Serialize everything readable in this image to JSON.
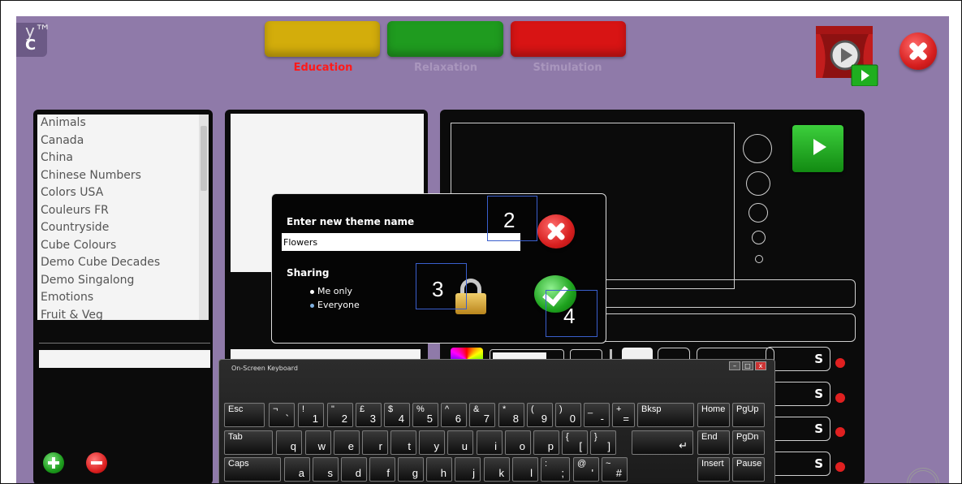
{
  "header": {
    "logo": {
      "top": "y™",
      "bottom": "C"
    },
    "categories": [
      {
        "label": "Education",
        "color": "#d3ad0b",
        "label_color": "#ff1a1a"
      },
      {
        "label": "Relaxation",
        "color": "#1f9b1f",
        "label_color": "#a996bd"
      },
      {
        "label": "Stimulation",
        "color": "#d81414",
        "label_color": "#a996bd"
      }
    ]
  },
  "theme_list": {
    "items": [
      "Animals",
      "Canada",
      "China",
      "Chinese Numbers",
      "Colors USA",
      "Couleurs FR",
      "Countryside",
      "Cube Colours",
      "Demo Cube Decades",
      "Demo Singalong",
      "Emotions",
      "Fruit & Veg"
    ]
  },
  "dialog": {
    "title": "Enter new theme name",
    "input_value": "Flowers",
    "sharing_label": "Sharing",
    "options": [
      "Me only",
      "Everyone"
    ],
    "selected_option": "Me only",
    "annotations": [
      "2",
      "3",
      "4"
    ]
  },
  "slots": {
    "labels": [
      "S",
      "S",
      "S",
      "S"
    ]
  },
  "keyboard": {
    "title": "On-Screen Keyboard",
    "controls": [
      "–",
      "□",
      "x"
    ],
    "row1": [
      {
        "top": "Esc",
        "main": ""
      },
      {
        "top": "¬",
        "main": "`"
      },
      {
        "top": "!",
        "main": "1"
      },
      {
        "top": "\"",
        "main": "2"
      },
      {
        "top": "£",
        "main": "3"
      },
      {
        "top": "$",
        "main": "4"
      },
      {
        "top": "%",
        "main": "5"
      },
      {
        "top": "^",
        "main": "6"
      },
      {
        "top": "&",
        "main": "7"
      },
      {
        "top": "*",
        "main": "8"
      },
      {
        "top": "(",
        "main": "9"
      },
      {
        "top": ")",
        "main": "0"
      },
      {
        "top": "_",
        "main": "-"
      },
      {
        "top": "+",
        "main": "="
      },
      {
        "top": "Bksp",
        "main": ""
      },
      {
        "top": "Home",
        "main": ""
      },
      {
        "top": "PgUp",
        "main": ""
      }
    ],
    "row2": [
      {
        "top": "Tab",
        "main": ""
      },
      {
        "top": "",
        "main": "q"
      },
      {
        "top": "",
        "main": "w"
      },
      {
        "top": "",
        "main": "e"
      },
      {
        "top": "",
        "main": "r"
      },
      {
        "top": "",
        "main": "t"
      },
      {
        "top": "",
        "main": "y"
      },
      {
        "top": "",
        "main": "u"
      },
      {
        "top": "",
        "main": "i"
      },
      {
        "top": "",
        "main": "o"
      },
      {
        "top": "",
        "main": "p"
      },
      {
        "top": "{",
        "main": "["
      },
      {
        "top": "}",
        "main": "]"
      },
      {
        "top": "",
        "main": "↵"
      },
      {
        "top": "End",
        "main": ""
      },
      {
        "top": "PgDn",
        "main": ""
      }
    ],
    "row3": [
      {
        "top": "Caps",
        "main": ""
      },
      {
        "top": "",
        "main": "a"
      },
      {
        "top": "",
        "main": "s"
      },
      {
        "top": "",
        "main": "d"
      },
      {
        "top": "",
        "main": "f"
      },
      {
        "top": "",
        "main": "g"
      },
      {
        "top": "",
        "main": "h"
      },
      {
        "top": "",
        "main": "j"
      },
      {
        "top": "",
        "main": "k"
      },
      {
        "top": "",
        "main": "l"
      },
      {
        "top": ":",
        "main": ";"
      },
      {
        "top": "@",
        "main": "'"
      },
      {
        "top": "~",
        "main": "#"
      },
      {
        "top": "Insert",
        "main": ""
      },
      {
        "top": "Pause",
        "main": ""
      }
    ]
  },
  "icons": {
    "close": "close-icon",
    "add": "plus-icon",
    "remove": "minus-icon",
    "play": "play-icon",
    "theatre": "theatre-play-icon",
    "lock": "lock-icon",
    "confirm": "checkmark-icon"
  }
}
